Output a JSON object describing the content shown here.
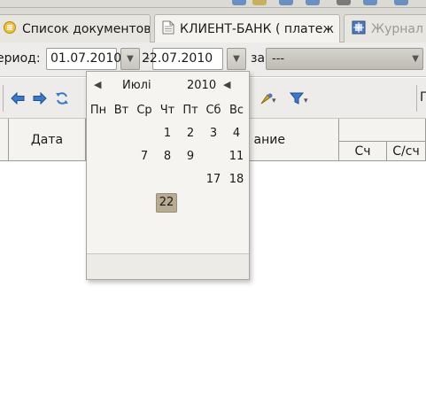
{
  "tabs": [
    {
      "label": "Список документов",
      "icon": "list-icon",
      "state": "normal"
    },
    {
      "label": "КЛИЕНТ-БАНК ( платеж",
      "icon": "document-icon",
      "state": "active"
    },
    {
      "label": "Журнал р",
      "icon": "journal-icon",
      "state": "inactive"
    }
  ],
  "period": {
    "label": "ериод:",
    "from": "01.07.2010",
    "separator": "-",
    "to": "22.07.2010",
    "za_label": "за",
    "range_value": "---"
  },
  "toolbar": {
    "right_label": "П"
  },
  "table": {
    "headers": {
      "date": "Дата",
      "description": "ание",
      "account": "Сч",
      "sub_account": "С/сч"
    }
  },
  "calendar": {
    "month": "Июлі",
    "year": "2010",
    "weekdays": [
      "Пн",
      "Вт",
      "Ср",
      "Чт",
      "Пт",
      "Сб",
      "Вс"
    ],
    "days": {
      "d1": "1",
      "d2": "2",
      "d3": "3",
      "d4": "4",
      "d7": "7",
      "d8": "8",
      "d9": "9",
      "d11": "11",
      "d17": "17",
      "d18": "18",
      "d22": "22"
    },
    "selected_day": "22"
  },
  "colors": {
    "chrome": "#dcdad5",
    "selected_day_bg": "#b8ab93",
    "border": "#9c9a94"
  }
}
